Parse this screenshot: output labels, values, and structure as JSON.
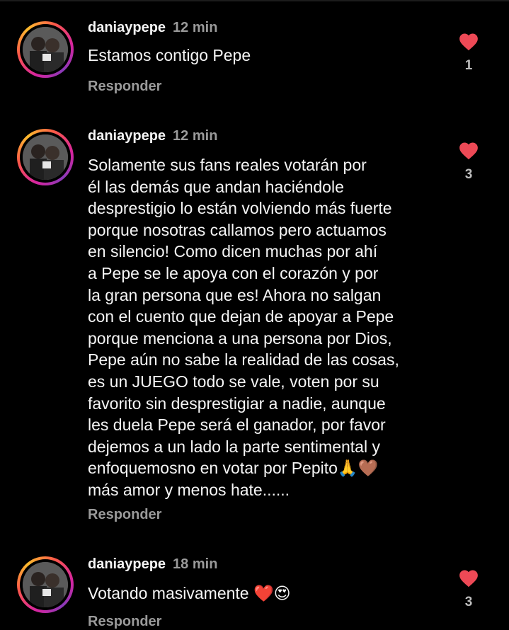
{
  "comments": [
    {
      "username": "daniaypepe",
      "time": "12 min",
      "text": "Estamos contigo Pepe",
      "reply_label": "Responder",
      "likes": "1"
    },
    {
      "username": "daniaypepe",
      "time": "12 min",
      "text": "Solamente sus fans reales votarán por\nél las demás que andan haciéndole\ndesprestigio lo están volviendo más fuerte\nporque nosotras callamos pero actuamos\nen silencio! Como dicen muchas por ahí\na Pepe se le apoya con el corazón y por\nla gran persona que es! Ahora no salgan\ncon el cuento que dejan de apoyar a Pepe\nporque menciona a una persona por Dios,\nPepe aún no sabe la realidad de las cosas,\nes un JUEGO todo se vale, voten por su\nfavorito sin desprestigiar a nadie, aunque\nles duela Pepe será el ganador, por favor\ndejemos a un lado la parte sentimental y\nenfoquemosno en votar por Pepito🙏🤎\nmás amor y menos hate......",
      "reply_label": "Responder",
      "likes": "3"
    },
    {
      "username": "daniaypepe",
      "time": "18 min",
      "text": "Votando masivamente ❤️😍",
      "reply_label": "Responder",
      "likes": "3"
    }
  ],
  "colors": {
    "background": "#000000",
    "text": "#f5f5f5",
    "muted": "#9a9a9a",
    "heart": "#ed4956"
  },
  "icons": {
    "like": "heart-icon",
    "avatar": "avatar-photo"
  }
}
